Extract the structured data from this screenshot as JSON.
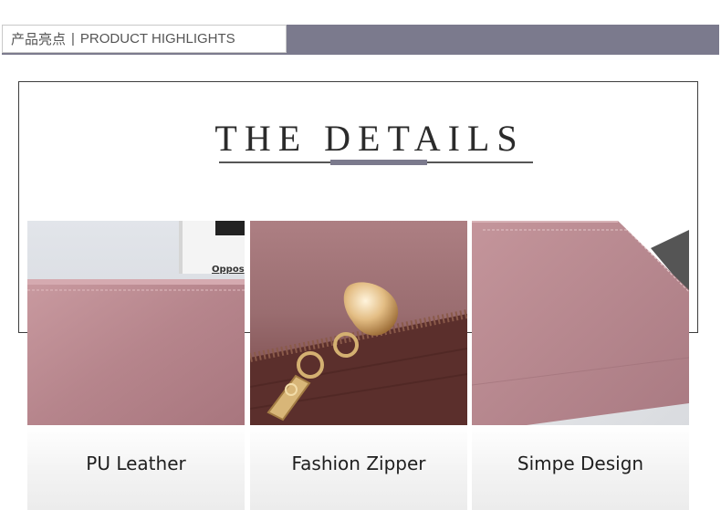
{
  "header": {
    "title_cn": "产品亮点",
    "separator": "|",
    "title_en": "PRODUCT HIGHLIGHTS"
  },
  "details": {
    "title": "THE DETAILS"
  },
  "panels": [
    {
      "caption": "PU Leather",
      "photo_text": "Oppos"
    },
    {
      "caption": "Fashion Zipper"
    },
    {
      "caption": "Simpe Design"
    }
  ],
  "colors": {
    "accent_bar": "#7b7a8d",
    "leather": "#b27e86",
    "zipper_lining": "#5a2e2c",
    "metal": "#d9b67a"
  }
}
